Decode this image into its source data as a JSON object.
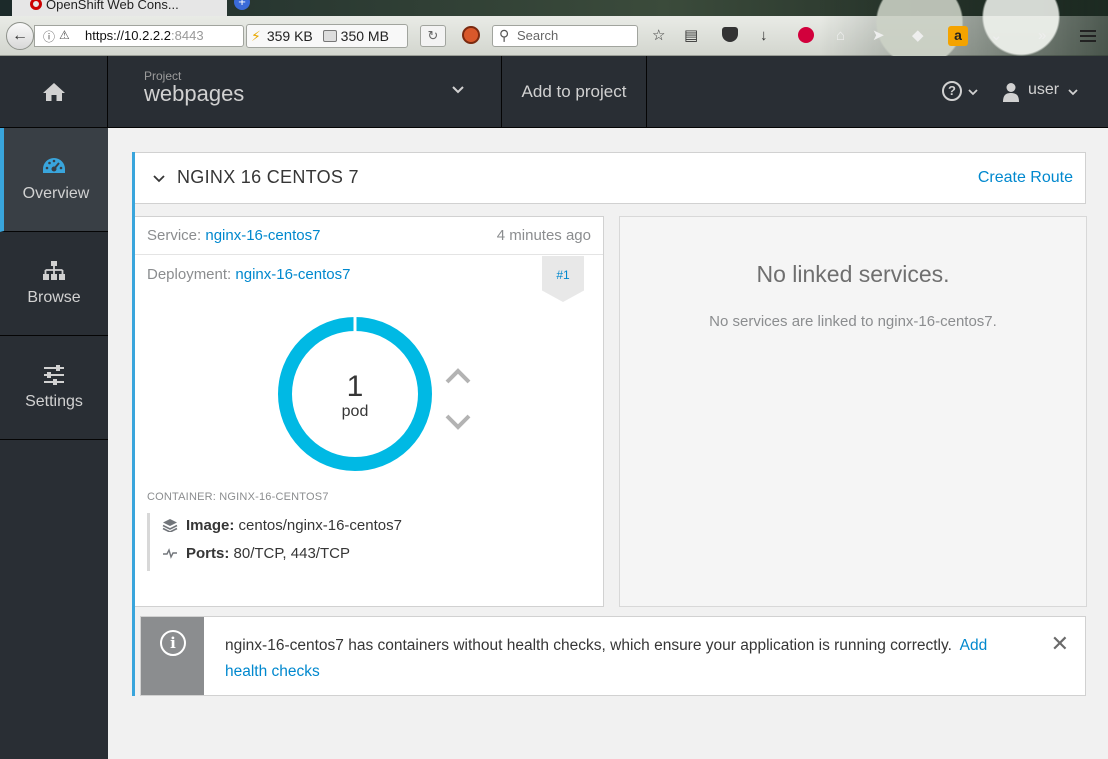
{
  "browser": {
    "tab_title": "OpenShift Web Cons...",
    "url_host": "https://10.2.2.2",
    "url_port": ":8443",
    "download_speed": "359 KB",
    "memory": "350 MB",
    "search_placeholder": "Search"
  },
  "header": {
    "project_label": "Project",
    "project_name": "webpages",
    "add_to_project": "Add to project",
    "help_symbol": "?",
    "user_name": "user"
  },
  "sidebar": {
    "items": [
      {
        "label": "Overview",
        "icon": "dashboard-icon",
        "active": true
      },
      {
        "label": "Browse",
        "icon": "sitemap-icon",
        "active": false
      },
      {
        "label": "Settings",
        "icon": "sliders-icon",
        "active": false
      }
    ]
  },
  "overview": {
    "group_title": "NGINX 16 CENTOS 7",
    "create_route": "Create Route",
    "service_label": "Service:",
    "service_name": "nginx-16-centos7",
    "service_age": "4 minutes ago",
    "deployment_label": "Deployment:",
    "deployment_name": "nginx-16-centos7",
    "deployment_version": "#1",
    "pod_count": "1",
    "pod_label": "pod",
    "container_label": "CONTAINER: NGINX-16-CENTOS7",
    "image_label": "Image:",
    "image_value": "centos/nginx-16-centos7",
    "ports_label": "Ports:",
    "ports_value": "80/TCP, 443/TCP",
    "linked_title": "No linked services.",
    "linked_subtitle": "No services are linked to nginx-16-centos7."
  },
  "alert": {
    "icon_symbol": "i",
    "message": "nginx-16-centos7 has containers without health checks, which ensure your application is running correctly.",
    "link_text": "Add health checks",
    "close_symbol": "✕"
  },
  "colors": {
    "accent": "#39a5dc",
    "link": "#0088ce",
    "nav_bg": "#292e34",
    "donut": "#00b9e4"
  }
}
